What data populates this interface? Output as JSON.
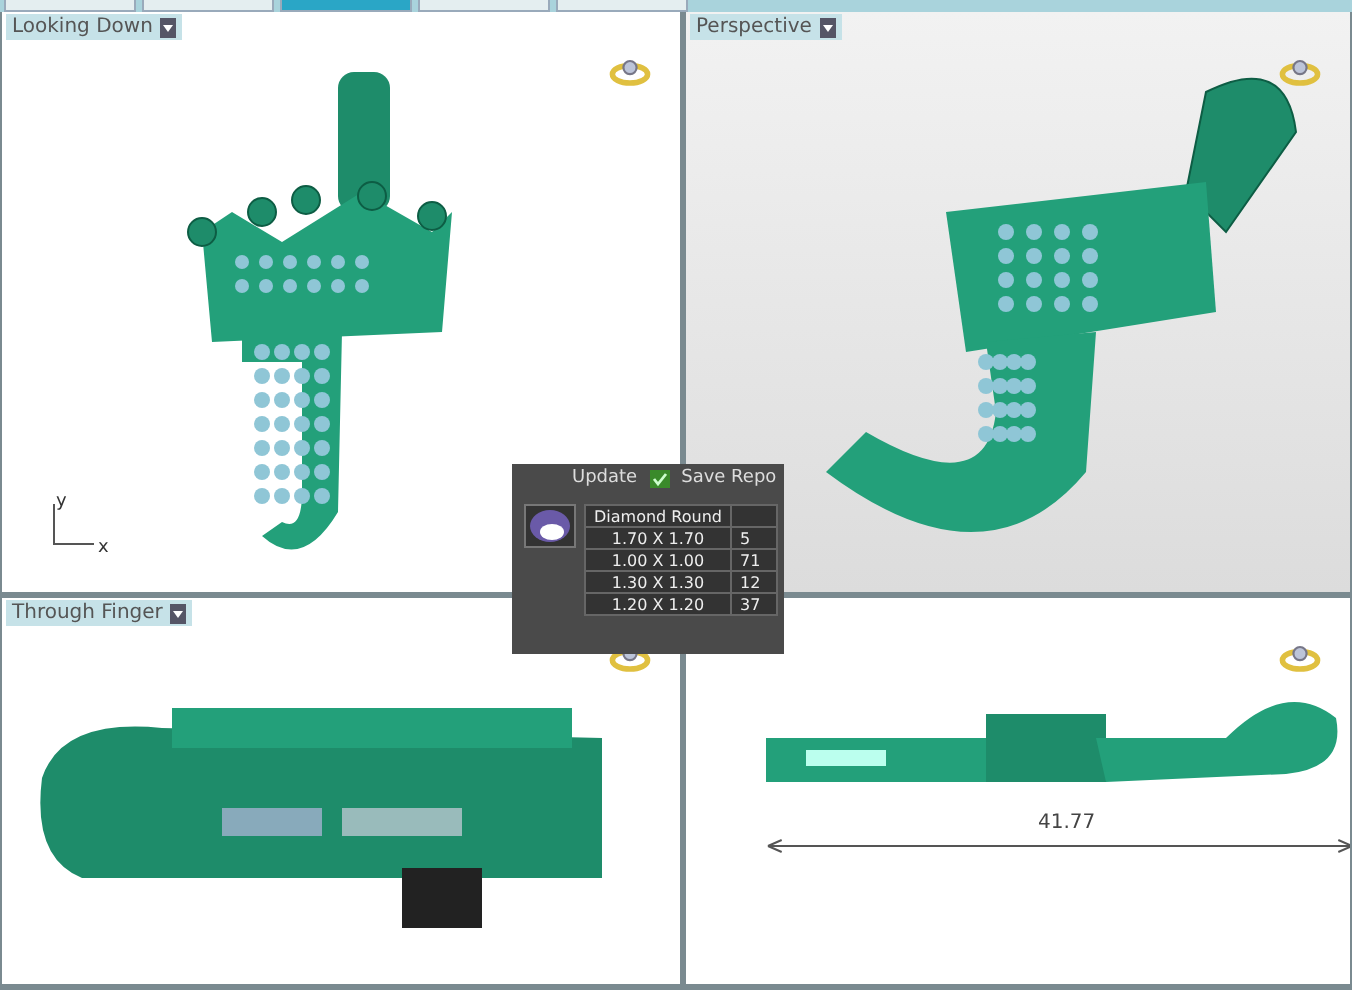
{
  "tab_strip": {
    "tabs": [
      {
        "selected": false
      },
      {
        "selected": false
      },
      {
        "selected": true
      },
      {
        "selected": false
      },
      {
        "selected": false
      }
    ]
  },
  "viewports": [
    {
      "kind": "front",
      "title": "Looking Down",
      "axes": {
        "y": "y",
        "x": "x"
      }
    },
    {
      "kind": "perspective",
      "title": "Perspective"
    },
    {
      "kind": "side",
      "title": "Through Finger"
    },
    {
      "kind": "profile",
      "dimension": "41.77"
    }
  ],
  "stone_panel": {
    "buttons": [
      "Update",
      "Save Repo"
    ],
    "columns": [
      "Diamond Round"
    ],
    "rows": [
      {
        "size": "1.70 X 1.70",
        "count": "5"
      },
      {
        "size": "1.00 X 1.00",
        "count": "71"
      },
      {
        "size": "1.30 X 1.30",
        "count": "12"
      },
      {
        "size": "1.20 X 1.20",
        "count": "37"
      }
    ]
  }
}
